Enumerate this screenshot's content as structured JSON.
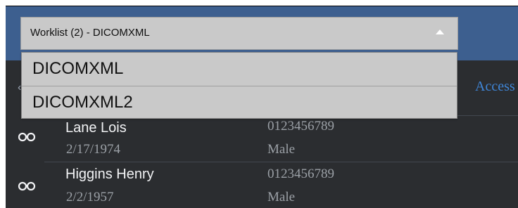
{
  "worklist_select": {
    "label": "Worklist (2) - DICOMXML"
  },
  "dropdown": {
    "options": [
      {
        "label": "DICOMXML"
      },
      {
        "label": "DICOMXML2"
      }
    ]
  },
  "list_header": {
    "accession_label": "Access"
  },
  "patients": [
    {
      "name": "Lane Lois",
      "dob": "2/17/1974",
      "id": "0123456789",
      "sex": "Male"
    },
    {
      "name": "Higgins Henry",
      "dob": "2/2/1957",
      "id": "0123456789",
      "sex": "Male"
    }
  ],
  "icons": {
    "row_icon": "glasses-icon",
    "select_caret": "caret-up-icon"
  },
  "colors": {
    "top_bar": "#3d5f8f",
    "background": "#2b2d30",
    "select_background": "#c9c9c9",
    "accent_link": "#3f86d8"
  }
}
